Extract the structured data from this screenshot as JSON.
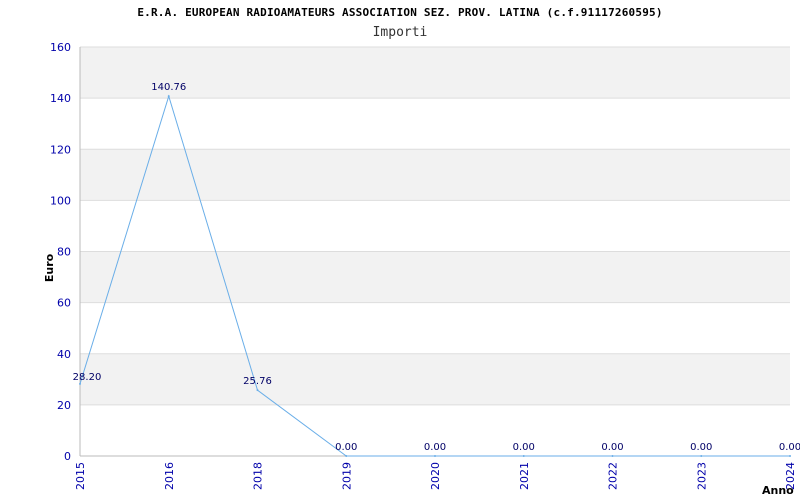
{
  "chart_data": {
    "type": "line",
    "title": "E.R.A. EUROPEAN RADIOAMATEURS ASSOCIATION SEZ. PROV. LATINA (c.f.91117260595)",
    "subtitle": "Importi",
    "xlabel": "Anno",
    "ylabel": "Euro",
    "categories": [
      "2015",
      "2016",
      "2018",
      "2019",
      "2020",
      "2021",
      "2022",
      "2023",
      "2024"
    ],
    "values": [
      28.2,
      140.76,
      25.76,
      0.0,
      0.0,
      0.0,
      0.0,
      0.0,
      0.0
    ],
    "data_labels": [
      "28.20",
      "140.76",
      "25.76",
      "0.00",
      "0.00",
      "0.00",
      "0.00",
      "0.00",
      "0.00"
    ],
    "ylim": [
      0,
      160
    ],
    "yticks": [
      0,
      20,
      40,
      60,
      80,
      100,
      120,
      140,
      160
    ],
    "grid": true,
    "line_color": "#6aaee8",
    "band_color": "#f2f2f2",
    "tick_color": "#0000aa"
  }
}
